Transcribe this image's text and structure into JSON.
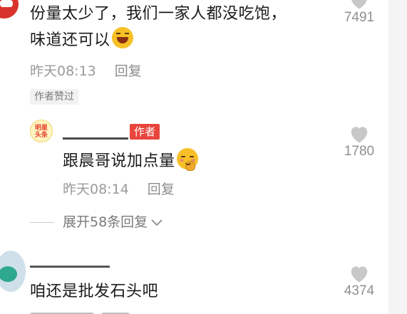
{
  "comments": {
    "top": {
      "text_line1": "份量太少了，我们一家人都没吃饱，",
      "text_line2": "味道还可以",
      "emoji": "laughing-face-icon",
      "time": "昨天08:13",
      "reply_label": "回复",
      "badge": "作者赞过",
      "like_count": "7491"
    },
    "reply": {
      "avatar_text_line1": "明星",
      "avatar_text_line2": "头条",
      "author_tag": "作者",
      "text": "跟晨哥说加点量",
      "emoji": "shy-face-icon",
      "time": "昨天08:14",
      "reply_label": "回复",
      "like_count": "1780"
    },
    "expand": {
      "label": "展开58条回复"
    },
    "third": {
      "text": "咱还是批发石头吧",
      "like_count": "4374"
    }
  },
  "colors": {
    "author_tag": "#e8453c",
    "meta_text": "#9a9a9a",
    "heart": "#c8c8c8"
  }
}
